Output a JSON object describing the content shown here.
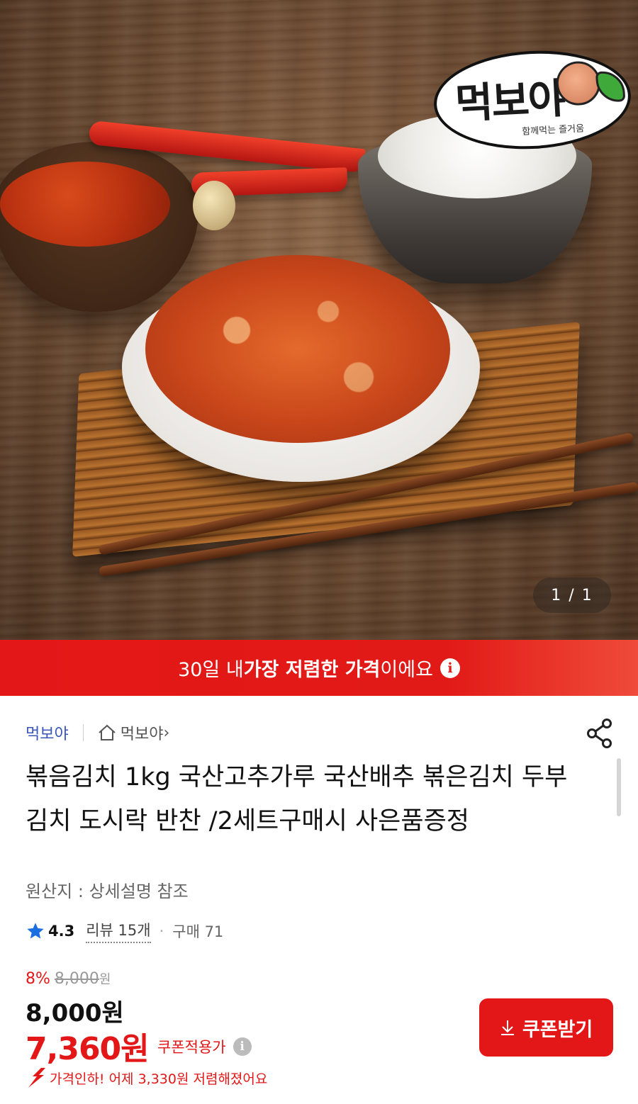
{
  "hero": {
    "logo_text": "먹보야",
    "logo_sub": "함께먹는 즐거움",
    "image_counter": "1 / 1"
  },
  "banner": {
    "prefix": "30일 내 ",
    "highlight": "가장 저렴한 가격",
    "suffix": "이에요",
    "info_glyph": "i"
  },
  "seller": {
    "name": "먹보야",
    "store_link": "먹보야",
    "store_chevron": "›"
  },
  "product": {
    "title": "볶음김치 1kg 국산고추가루 국산배추 볶은김치 두부김치 도시락 반찬 /2세트구매시 사은품증정",
    "origin": "원산지 : 상세설명 참조"
  },
  "rating": {
    "score": "4.3",
    "reviews": "리뷰 15개",
    "separator": "·",
    "purchases": "구매 71"
  },
  "price": {
    "discount_rate": "8%",
    "original": "8,000",
    "original_unit": "원",
    "sale": "8,000원",
    "coupon_price": "7,360원",
    "coupon_label": "쿠폰적용가",
    "info_glyph": "i",
    "drop_notice": "가격인하! 어제 3,330원 저렴해졌어요"
  },
  "actions": {
    "coupon_button": "쿠폰받기"
  },
  "colors": {
    "accent_red": "#e31717",
    "seller_blue": "#3a56b8",
    "star_blue": "#1a6fe0"
  }
}
